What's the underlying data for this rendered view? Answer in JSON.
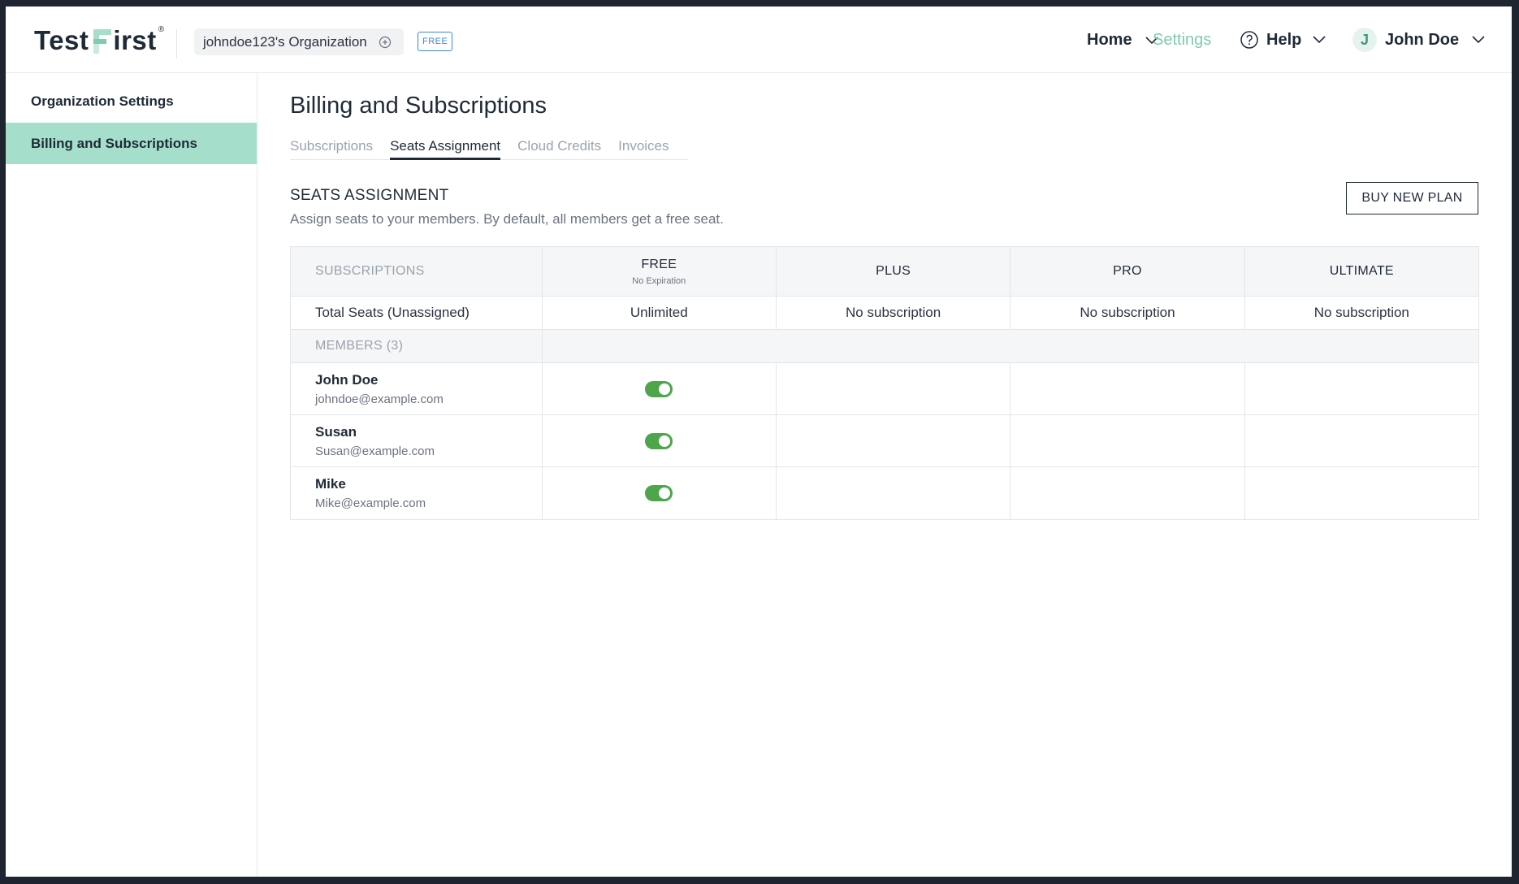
{
  "brand": {
    "name_part1": "Test",
    "name_part2": "irst",
    "registered_mark": "®"
  },
  "header": {
    "organization": "johndoe123's Organization",
    "plan_badge": "FREE",
    "nav": {
      "home": "Home",
      "settings": "Settings",
      "help": "Help",
      "user_initial": "J",
      "user_name": "John Doe"
    }
  },
  "sidebar": {
    "items": [
      {
        "label": "Organization Settings",
        "active": false
      },
      {
        "label": "Billing and Subscriptions",
        "active": true
      }
    ]
  },
  "main": {
    "title": "Billing and Subscriptions",
    "tabs": [
      {
        "label": "Subscriptions",
        "active": false
      },
      {
        "label": "Seats Assignment",
        "active": true
      },
      {
        "label": "Cloud Credits",
        "active": false
      },
      {
        "label": "Invoices",
        "active": false
      }
    ],
    "section": {
      "title": "SEATS ASSIGNMENT",
      "description": "Assign seats to your members. By default, all members get a free seat.",
      "buy_button": "BUY NEW PLAN"
    },
    "table": {
      "header": {
        "subscriptions": "SUBSCRIPTIONS",
        "free": "FREE",
        "free_sub": "No Expiration",
        "plus": "PLUS",
        "pro": "PRO",
        "ultimate": "ULTIMATE"
      },
      "totals": {
        "label": "Total Seats (Unassigned)",
        "free": "Unlimited",
        "plus": "No subscription",
        "pro": "No subscription",
        "ultimate": "No subscription"
      },
      "members_label": "MEMBERS (3)",
      "members": [
        {
          "name": "John Doe",
          "email": "johndoe@example.com",
          "free_seat": true
        },
        {
          "name": "Susan",
          "email": "Susan@example.com",
          "free_seat": true
        },
        {
          "name": "Mike",
          "email": "Mike@example.com",
          "free_seat": true
        }
      ]
    }
  },
  "colors": {
    "accent_green": "#a5dfcc",
    "settings_link": "#7ecbb0",
    "toggle_on": "#4ea54c",
    "badge_blue": "#3f86d6",
    "text_dark": "#1f2a37",
    "text_muted": "#9aa3ad"
  },
  "icons": [
    "add-circle-icon",
    "chevron-down-icon",
    "help-circle-icon"
  ]
}
